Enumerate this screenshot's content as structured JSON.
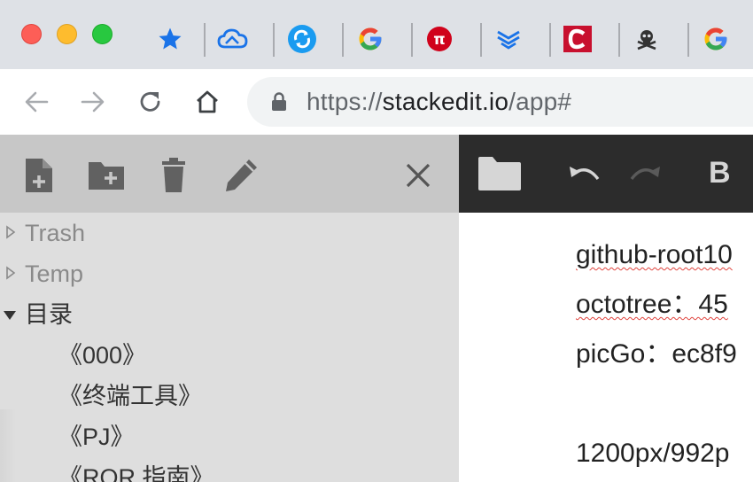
{
  "browser": {
    "bookmarks": [
      {
        "icon": "star-icon",
        "color": "#1a73e8"
      },
      {
        "icon": "cloud-icon",
        "color": "#1a73e8"
      },
      {
        "icon": "sync-icon",
        "color": "#1a9bf0"
      },
      {
        "icon": "google-icon",
        "color": "#4285f4"
      },
      {
        "icon": "pi-icon",
        "color": "#d0021b"
      },
      {
        "icon": "layers-icon",
        "color": "#1a73e8"
      },
      {
        "icon": "c-logo-icon",
        "color": "#c8102e"
      },
      {
        "icon": "skull-icon",
        "color": "#333333"
      },
      {
        "icon": "google-icon",
        "color": "#4285f4"
      }
    ],
    "url": {
      "scheme": "https://",
      "host": "stackedit.io",
      "path": "/app#"
    }
  },
  "explorer": {
    "toolbar": [
      "new-file-icon",
      "new-folder-icon",
      "delete-icon",
      "rename-icon",
      "close-icon"
    ],
    "items": [
      {
        "label": "Trash",
        "expanded": false
      },
      {
        "label": "Temp",
        "expanded": false
      },
      {
        "label": "目录",
        "expanded": true
      },
      {
        "label": "《000》"
      },
      {
        "label": "《终端工具》"
      },
      {
        "label": "《PJ》"
      },
      {
        "label": "《ROR 指南》"
      }
    ]
  },
  "editor": {
    "toolbar": [
      "folder-icon",
      "undo-icon",
      "redo-icon",
      "bold-icon"
    ],
    "bold_label": "B",
    "lines": [
      "github-root10",
      "octotree：45",
      "picGo：ec8f9",
      "",
      "1200px/992p"
    ]
  }
}
